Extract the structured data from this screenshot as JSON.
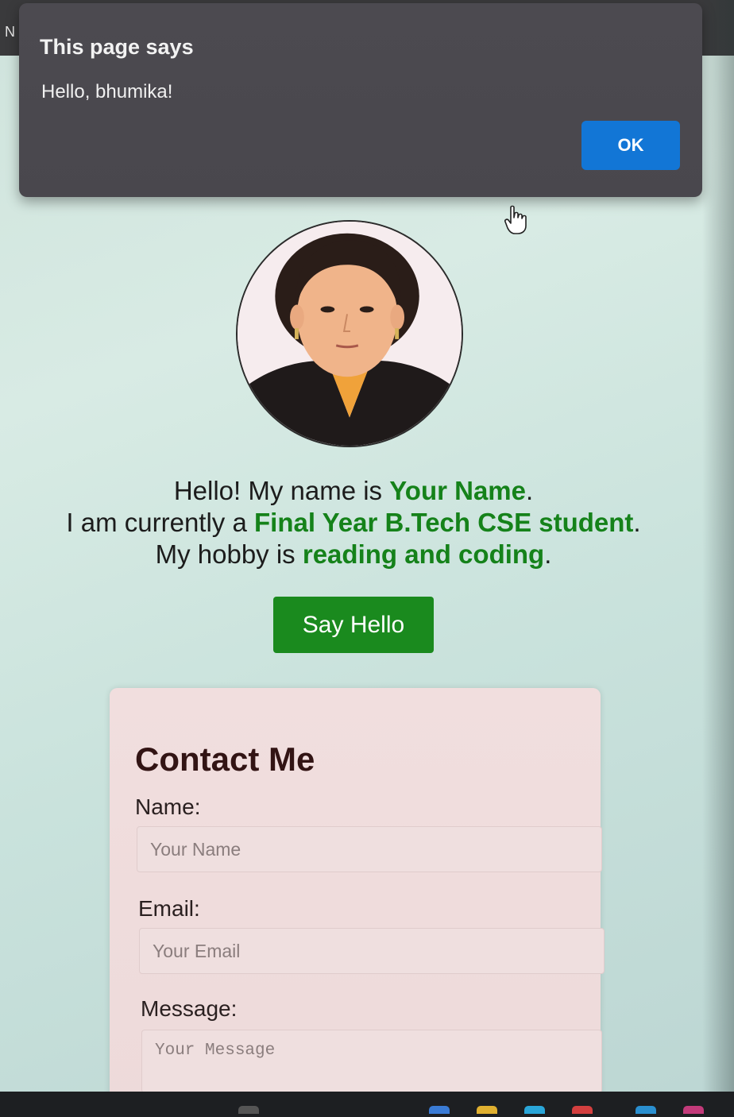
{
  "browser": {
    "tab_letter": "N"
  },
  "alert": {
    "title": "This page says",
    "message": "Hello, bhumika!",
    "ok_label": "OK"
  },
  "profile": {
    "line1_prefix": "Hello! My name is ",
    "name": "Your Name",
    "line1_suffix": ".",
    "line2_prefix": "I am currently a ",
    "status": "Final Year B.Tech CSE student",
    "line2_suffix": ".",
    "line3_prefix": "My hobby is ",
    "hobby": "reading and coding",
    "line3_suffix": "."
  },
  "say_hello_button": "Say Hello",
  "contact": {
    "title": "Contact Me",
    "name_label": "Name:",
    "name_placeholder": "Your Name",
    "email_label": "Email:",
    "email_placeholder": "Your Email",
    "message_label": "Message:",
    "message_placeholder": "Your Message"
  },
  "colors": {
    "accent_green": "#15821a",
    "button_green": "#1a8a1e",
    "ok_blue": "#1276d6",
    "alert_bg": "#4c4a50",
    "card_bg": "#f1dede"
  }
}
